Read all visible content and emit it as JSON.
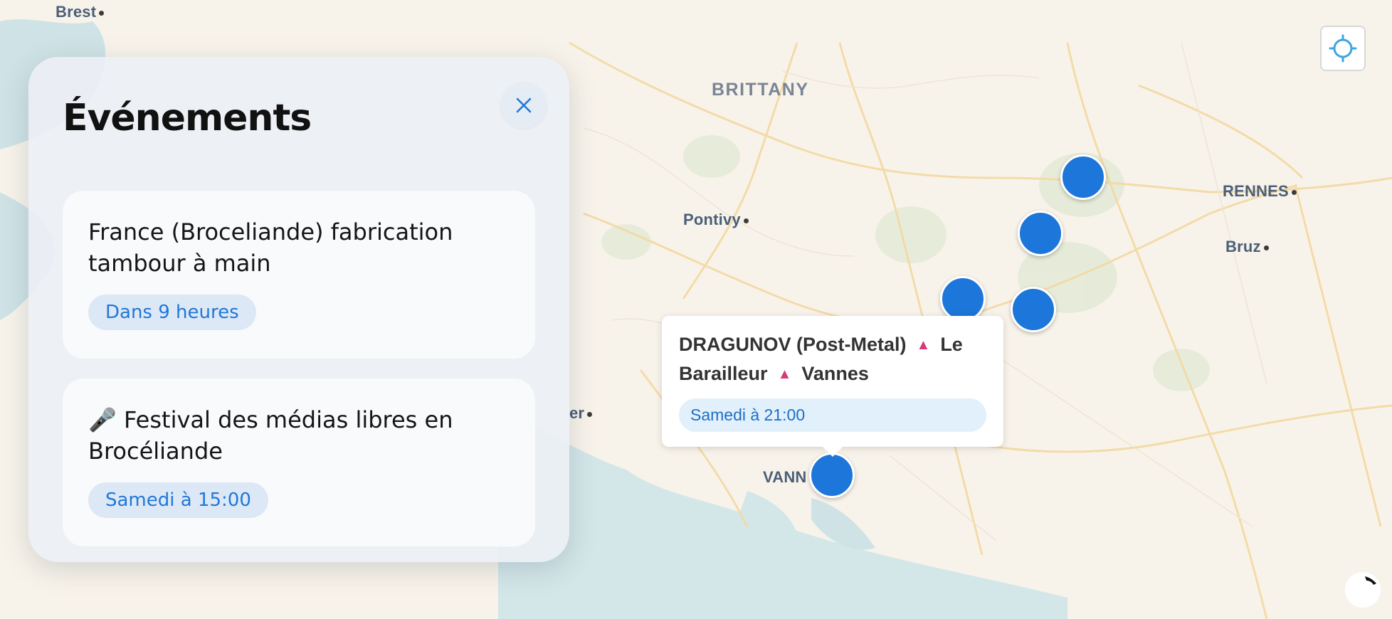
{
  "map": {
    "cities": [
      {
        "name": "Brest",
        "id": "city-brest"
      },
      {
        "name": "Pontivy",
        "id": "city-pontivy"
      },
      {
        "name": "RENNES",
        "id": "city-rennes"
      },
      {
        "name": "Bruz",
        "id": "city-bruz"
      },
      {
        "name": "er",
        "id": "city-partial"
      },
      {
        "name": "VANN",
        "id": "city-vannes"
      }
    ],
    "region_label": "BRITTANY",
    "marker_color": "#1d76d9"
  },
  "panel": {
    "title": "Événements",
    "events": [
      {
        "title": "France (Broceliande) fabrication tambour à main",
        "time": "Dans 9 heures"
      },
      {
        "icon": "microphone-icon",
        "title_emoji": "🎤",
        "title": "Festival des médias libres en Brocéliande",
        "time": "Samedi à 15:00"
      }
    ]
  },
  "popup": {
    "parts": [
      "DRAGUNOV (Post-Metal)",
      "Le Barailleur",
      "Vannes"
    ],
    "separator": "▲",
    "time": "Samedi à 21:00"
  },
  "colors": {
    "accent": "#1d76d9",
    "badge_bg": "#dde8f6",
    "separator": "#d63a78"
  }
}
